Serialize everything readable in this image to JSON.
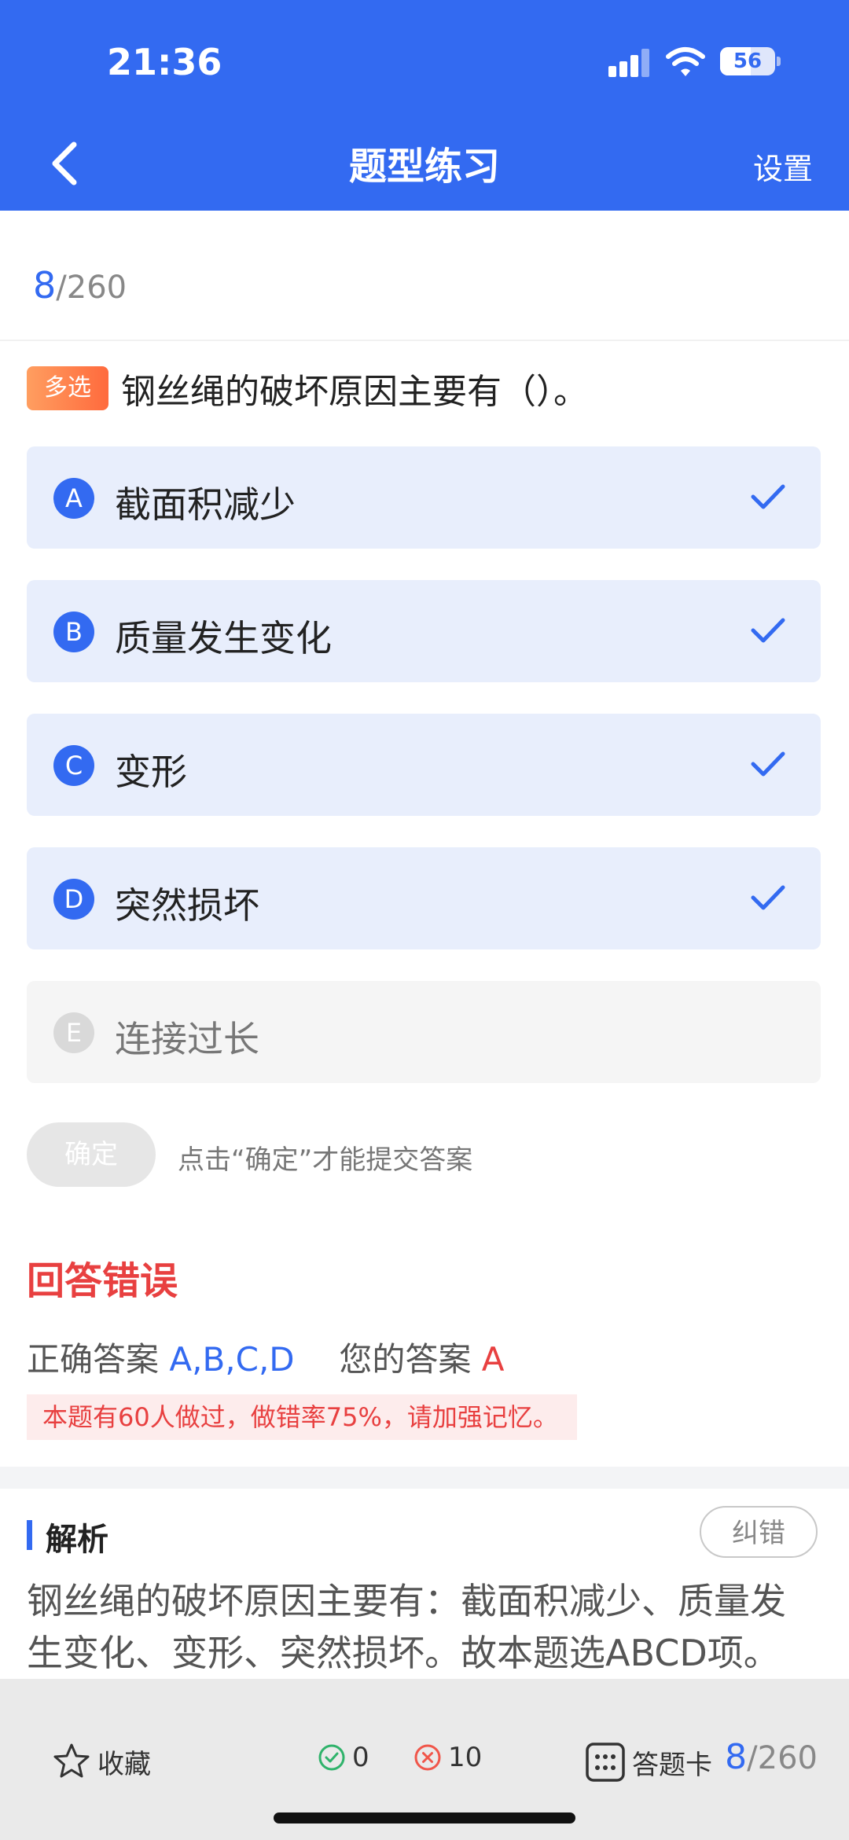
{
  "status_bar": {
    "time": "21:36",
    "battery": "56",
    "battery_level": 0.56
  },
  "header": {
    "title": "题型练习",
    "settings_label": "设置"
  },
  "progress": {
    "current": "8",
    "total": "/260"
  },
  "question": {
    "type_tag": "多选",
    "text": "钢丝绳的破坏原因主要有（）。",
    "options": [
      {
        "letter": "A",
        "text": "截面积减少",
        "selected": true
      },
      {
        "letter": "B",
        "text": "质量发生变化",
        "selected": true
      },
      {
        "letter": "C",
        "text": "变形",
        "selected": true
      },
      {
        "letter": "D",
        "text": "突然损坏",
        "selected": true
      },
      {
        "letter": "E",
        "text": "连接过长",
        "selected": false
      }
    ]
  },
  "confirm": {
    "label": "确定",
    "hint": "点击“确定”才能提交答案"
  },
  "result": {
    "title": "回答错误",
    "correct_label": "正确答案",
    "correct_value": "A,B,C,D",
    "your_label": "您的答案",
    "your_value": "A",
    "stat": "本题有60人做过，做错率75%，请加强记忆。"
  },
  "analysis": {
    "title": "解析",
    "report_label": "纠错",
    "text": "钢丝绳的破坏原因主要有：截面积减少、质量发生变化、变形、突然损坏。故本题选ABCD项。"
  },
  "bottom_bar": {
    "favorite_label": "收藏",
    "correct_count": "0",
    "wrong_count": "10",
    "answer_card_label": "答题卡",
    "current": "8",
    "total": "/260"
  },
  "colors": {
    "primary": "#336af1",
    "error": "#e84040",
    "correct_green": "#2fb36b",
    "wrong_red": "#f0564a"
  }
}
